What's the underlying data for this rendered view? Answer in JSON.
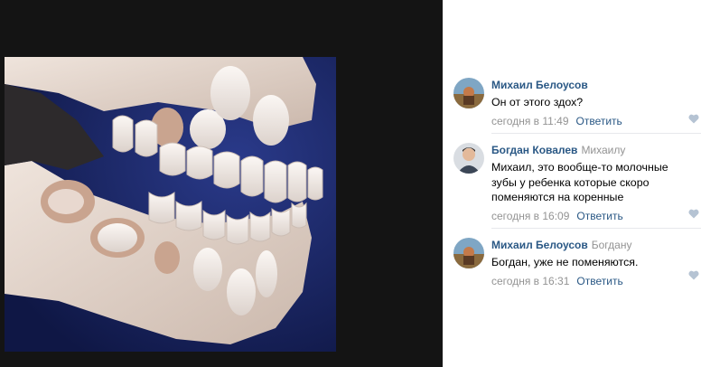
{
  "comments": [
    {
      "author": "Михаил Белоусов",
      "reply_to": "",
      "text": "Он от этого здох?",
      "date": "сегодня в 11:49",
      "reply_label": "Ответить",
      "avatar": "landscape-avatar"
    },
    {
      "author": "Богдан Ковалев",
      "reply_to": "Михаилу",
      "text": "Михаил, это вообще-то молочные зубы у ребенка которые скоро поменяются на коренные",
      "date": "сегодня в 16:09",
      "reply_label": "Ответить",
      "avatar": "person-avatar"
    },
    {
      "author": "Михаил Белоусов",
      "reply_to": "Богдану",
      "text": "Богдан, уже не поменяются.",
      "date": "сегодня в 16:31",
      "reply_label": "Ответить",
      "avatar": "landscape-avatar"
    }
  ],
  "colors": {
    "link": "#2a5885",
    "muted": "#939393",
    "viewer_bg": "#141414",
    "photo_bg": "#16205a",
    "like_icon": "#b5c3d3"
  },
  "icons": {
    "like": "heart-icon"
  }
}
